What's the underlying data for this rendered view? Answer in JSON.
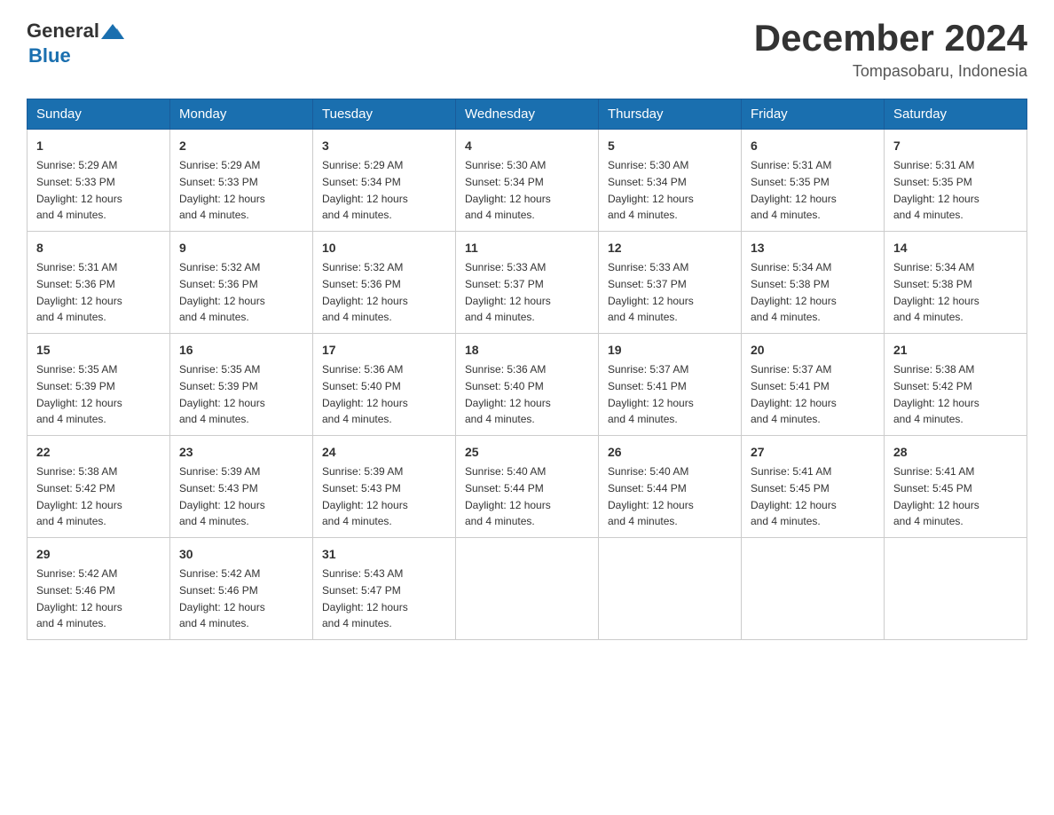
{
  "header": {
    "logo_general": "General",
    "logo_blue": "Blue",
    "month_year": "December 2024",
    "location": "Tompasobaru, Indonesia"
  },
  "days": [
    "Sunday",
    "Monday",
    "Tuesday",
    "Wednesday",
    "Thursday",
    "Friday",
    "Saturday"
  ],
  "weeks": [
    [
      {
        "day": "1",
        "sunrise": "5:29 AM",
        "sunset": "5:33 PM",
        "daylight": "12 hours and 4 minutes."
      },
      {
        "day": "2",
        "sunrise": "5:29 AM",
        "sunset": "5:33 PM",
        "daylight": "12 hours and 4 minutes."
      },
      {
        "day": "3",
        "sunrise": "5:29 AM",
        "sunset": "5:34 PM",
        "daylight": "12 hours and 4 minutes."
      },
      {
        "day": "4",
        "sunrise": "5:30 AM",
        "sunset": "5:34 PM",
        "daylight": "12 hours and 4 minutes."
      },
      {
        "day": "5",
        "sunrise": "5:30 AM",
        "sunset": "5:34 PM",
        "daylight": "12 hours and 4 minutes."
      },
      {
        "day": "6",
        "sunrise": "5:31 AM",
        "sunset": "5:35 PM",
        "daylight": "12 hours and 4 minutes."
      },
      {
        "day": "7",
        "sunrise": "5:31 AM",
        "sunset": "5:35 PM",
        "daylight": "12 hours and 4 minutes."
      }
    ],
    [
      {
        "day": "8",
        "sunrise": "5:31 AM",
        "sunset": "5:36 PM",
        "daylight": "12 hours and 4 minutes."
      },
      {
        "day": "9",
        "sunrise": "5:32 AM",
        "sunset": "5:36 PM",
        "daylight": "12 hours and 4 minutes."
      },
      {
        "day": "10",
        "sunrise": "5:32 AM",
        "sunset": "5:36 PM",
        "daylight": "12 hours and 4 minutes."
      },
      {
        "day": "11",
        "sunrise": "5:33 AM",
        "sunset": "5:37 PM",
        "daylight": "12 hours and 4 minutes."
      },
      {
        "day": "12",
        "sunrise": "5:33 AM",
        "sunset": "5:37 PM",
        "daylight": "12 hours and 4 minutes."
      },
      {
        "day": "13",
        "sunrise": "5:34 AM",
        "sunset": "5:38 PM",
        "daylight": "12 hours and 4 minutes."
      },
      {
        "day": "14",
        "sunrise": "5:34 AM",
        "sunset": "5:38 PM",
        "daylight": "12 hours and 4 minutes."
      }
    ],
    [
      {
        "day": "15",
        "sunrise": "5:35 AM",
        "sunset": "5:39 PM",
        "daylight": "12 hours and 4 minutes."
      },
      {
        "day": "16",
        "sunrise": "5:35 AM",
        "sunset": "5:39 PM",
        "daylight": "12 hours and 4 minutes."
      },
      {
        "day": "17",
        "sunrise": "5:36 AM",
        "sunset": "5:40 PM",
        "daylight": "12 hours and 4 minutes."
      },
      {
        "day": "18",
        "sunrise": "5:36 AM",
        "sunset": "5:40 PM",
        "daylight": "12 hours and 4 minutes."
      },
      {
        "day": "19",
        "sunrise": "5:37 AM",
        "sunset": "5:41 PM",
        "daylight": "12 hours and 4 minutes."
      },
      {
        "day": "20",
        "sunrise": "5:37 AM",
        "sunset": "5:41 PM",
        "daylight": "12 hours and 4 minutes."
      },
      {
        "day": "21",
        "sunrise": "5:38 AM",
        "sunset": "5:42 PM",
        "daylight": "12 hours and 4 minutes."
      }
    ],
    [
      {
        "day": "22",
        "sunrise": "5:38 AM",
        "sunset": "5:42 PM",
        "daylight": "12 hours and 4 minutes."
      },
      {
        "day": "23",
        "sunrise": "5:39 AM",
        "sunset": "5:43 PM",
        "daylight": "12 hours and 4 minutes."
      },
      {
        "day": "24",
        "sunrise": "5:39 AM",
        "sunset": "5:43 PM",
        "daylight": "12 hours and 4 minutes."
      },
      {
        "day": "25",
        "sunrise": "5:40 AM",
        "sunset": "5:44 PM",
        "daylight": "12 hours and 4 minutes."
      },
      {
        "day": "26",
        "sunrise": "5:40 AM",
        "sunset": "5:44 PM",
        "daylight": "12 hours and 4 minutes."
      },
      {
        "day": "27",
        "sunrise": "5:41 AM",
        "sunset": "5:45 PM",
        "daylight": "12 hours and 4 minutes."
      },
      {
        "day": "28",
        "sunrise": "5:41 AM",
        "sunset": "5:45 PM",
        "daylight": "12 hours and 4 minutes."
      }
    ],
    [
      {
        "day": "29",
        "sunrise": "5:42 AM",
        "sunset": "5:46 PM",
        "daylight": "12 hours and 4 minutes."
      },
      {
        "day": "30",
        "sunrise": "5:42 AM",
        "sunset": "5:46 PM",
        "daylight": "12 hours and 4 minutes."
      },
      {
        "day": "31",
        "sunrise": "5:43 AM",
        "sunset": "5:47 PM",
        "daylight": "12 hours and 4 minutes."
      },
      null,
      null,
      null,
      null
    ]
  ],
  "labels": {
    "sunrise": "Sunrise:",
    "sunset": "Sunset:",
    "daylight": "Daylight:"
  }
}
